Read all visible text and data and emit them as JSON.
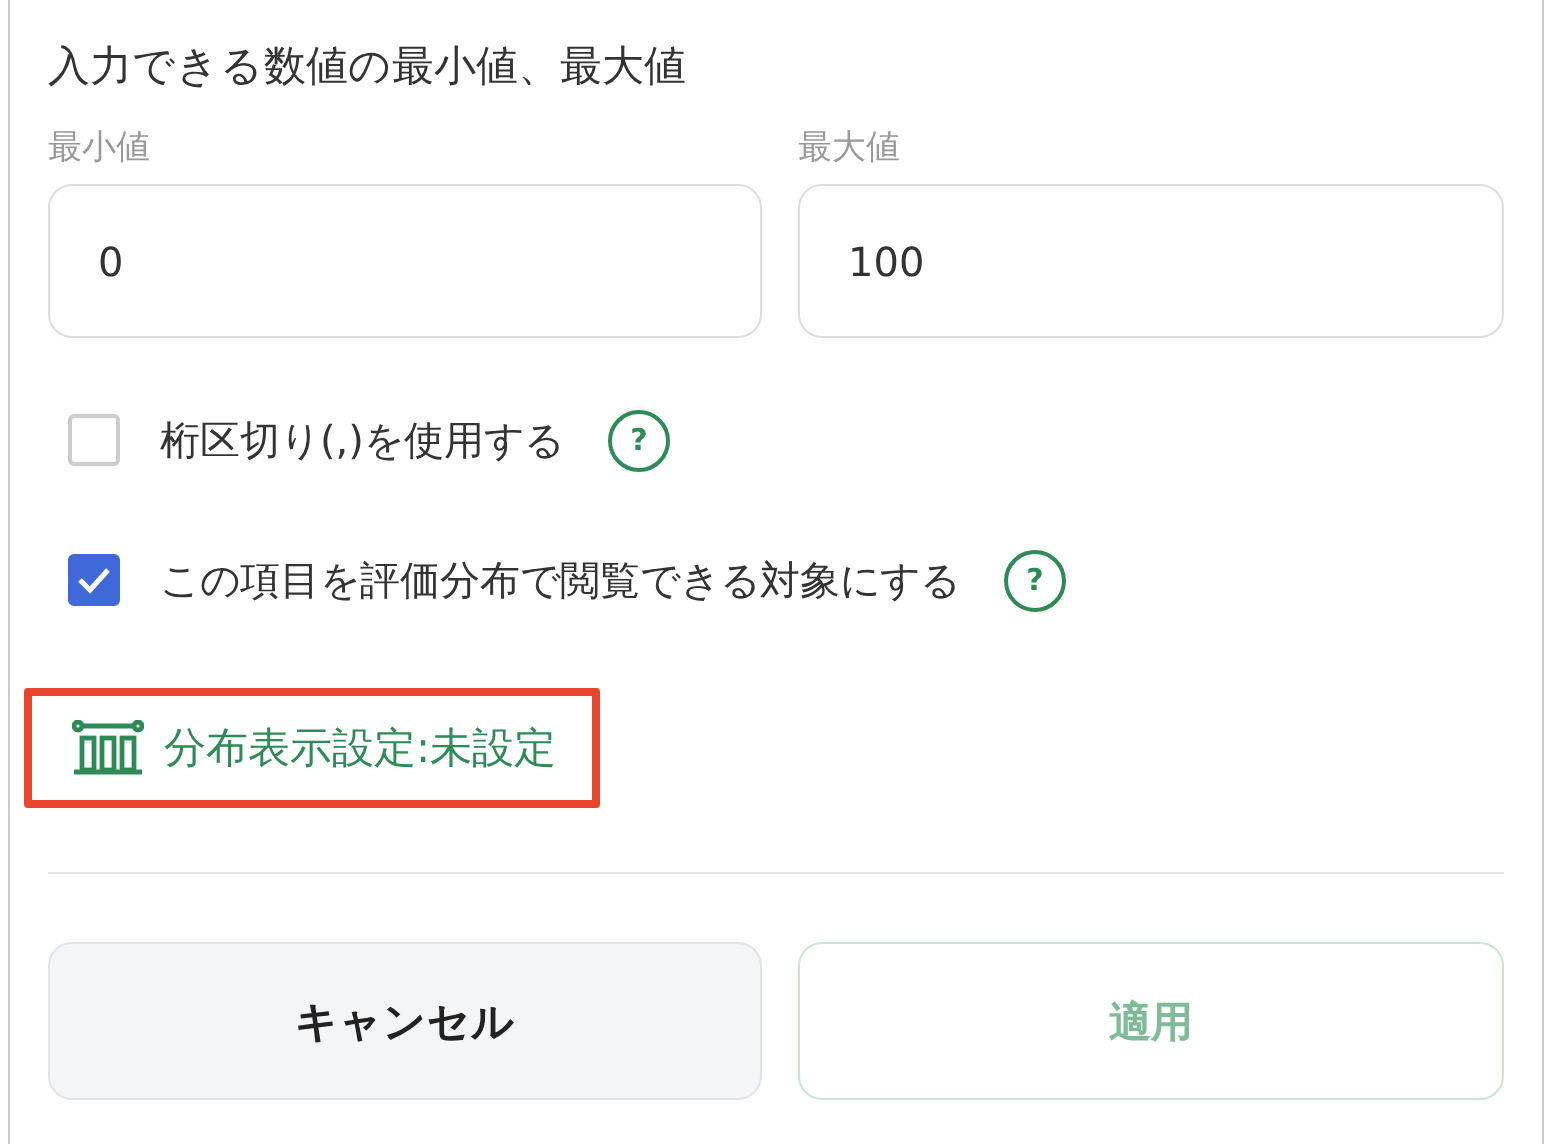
{
  "range_section": {
    "title": "入力できる数値の最小値、最大値",
    "fields": [
      {
        "label": "最小値",
        "value": "0"
      },
      {
        "label": "最大値",
        "value": "100"
      }
    ]
  },
  "options": [
    {
      "label": "桁区切り(,)を使用する",
      "checked": false,
      "help": "?"
    },
    {
      "label": "この項目を評価分布で閲覧できる対象にする",
      "checked": true,
      "help": "?"
    }
  ],
  "distribution_link": {
    "label": "分布表示設定:未設定",
    "highlighted": true
  },
  "buttons": [
    {
      "label": "キャンセル",
      "kind": "secondary",
      "disabled": false
    },
    {
      "label": "適用",
      "kind": "primary",
      "disabled": true
    }
  ]
}
